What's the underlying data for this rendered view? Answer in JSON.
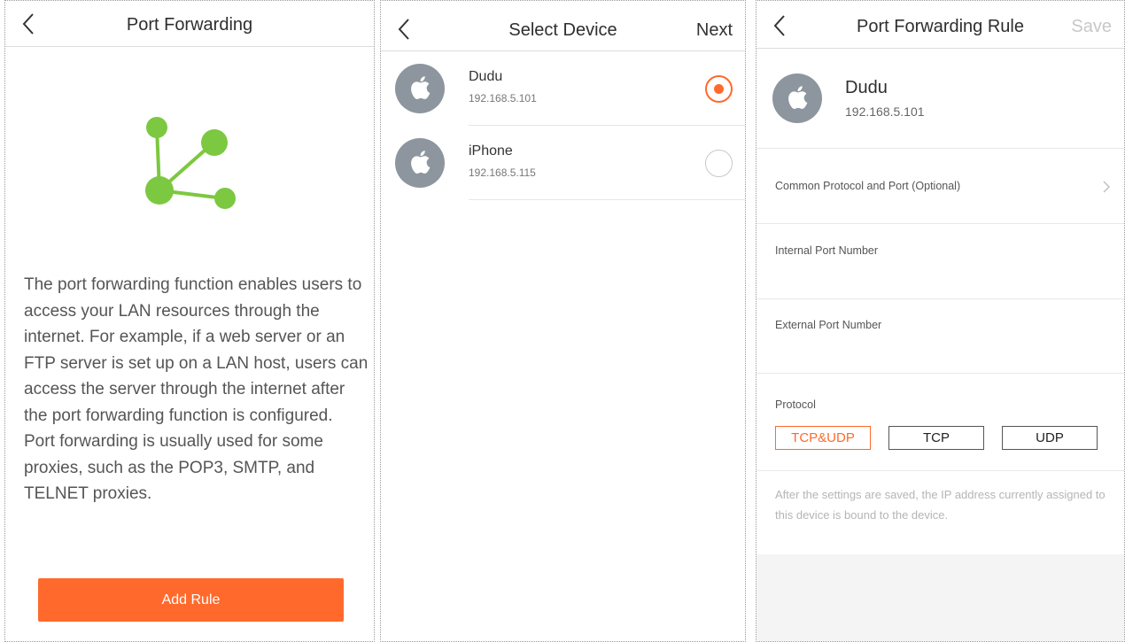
{
  "colors": {
    "accent": "#ff6a2c",
    "logo_green": "#7cc840",
    "avatar_gray": "#8d969e"
  },
  "panel1": {
    "title": "Port Forwarding",
    "back_icon": "chevron-left-icon",
    "logo_icon": "port-forwarding-icon",
    "description": [
      "The port forwarding function enables users to access your LAN resources through the internet. For example, if a web server or an FTP server is set up on a LAN host, users can access the server through the internet after the port forwarding function is configured.",
      "Port forwarding is usually used for some proxies, such as the POP3, SMTP, and TELNET proxies."
    ],
    "add_rule_label": "Add Rule"
  },
  "panel2": {
    "title": "Select Device",
    "next_label": "Next",
    "devices": [
      {
        "name": "Dudu",
        "ip": "192.168.5.101",
        "icon": "apple-icon",
        "selected": true
      },
      {
        "name": "iPhone",
        "ip": "192.168.5.115",
        "icon": "apple-icon",
        "selected": false
      }
    ]
  },
  "panel3": {
    "title": "Port Forwarding Rule",
    "save_label": "Save",
    "device": {
      "name": "Dudu",
      "ip": "192.168.5.101",
      "icon": "apple-icon"
    },
    "common_protocol_label": "Common Protocol and Port (Optional)",
    "internal_port_label": "Internal Port Number",
    "internal_port_value": "",
    "external_port_label": "External Port Number",
    "external_port_value": "",
    "protocol_label": "Protocol",
    "protocols": [
      "TCP&UDP",
      "TCP",
      "UDP"
    ],
    "selected_protocol": "TCP&UDP",
    "note": "After the settings are saved, the IP address currently assigned to this device is bound to the device."
  }
}
